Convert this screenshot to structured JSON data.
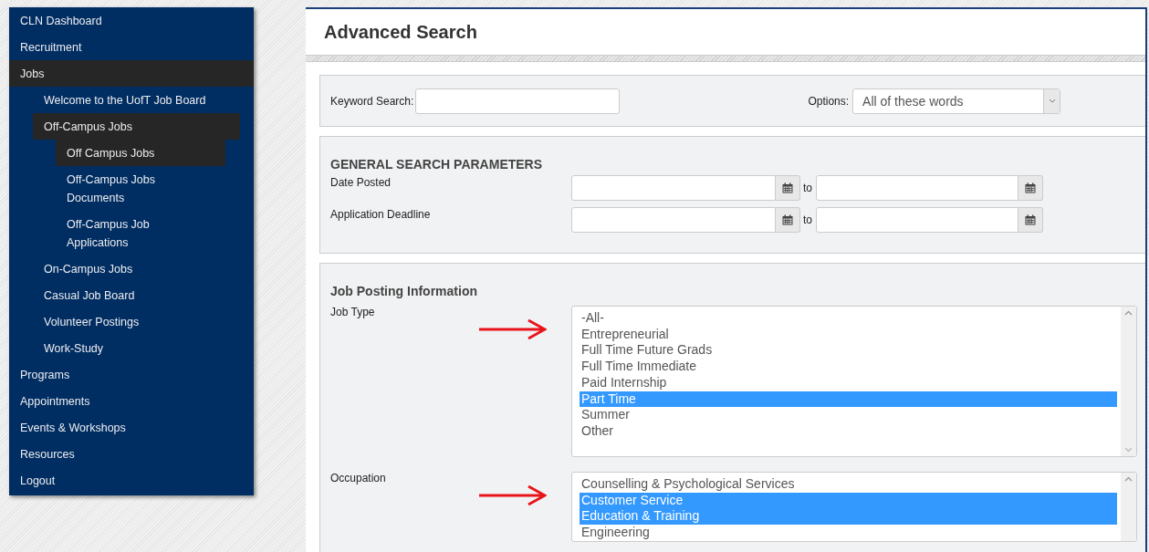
{
  "sidebar": {
    "items": [
      {
        "label": "CLN Dashboard",
        "selected": false
      },
      {
        "label": "Recruitment",
        "selected": false
      },
      {
        "label": "Jobs",
        "selected": true,
        "children": [
          {
            "label": "Welcome to the UofT Job Board",
            "selected": false
          },
          {
            "label": "Off-Campus Jobs",
            "selected": true,
            "children": [
              {
                "label": "Off Campus Jobs",
                "selected": true
              },
              {
                "label": "Off-Campus Jobs Documents",
                "selected": false
              },
              {
                "label": "Off-Campus Job Applications",
                "selected": false
              }
            ]
          },
          {
            "label": "On-Campus Jobs",
            "selected": false
          },
          {
            "label": "Casual Job Board",
            "selected": false
          },
          {
            "label": "Volunteer Postings",
            "selected": false
          },
          {
            "label": "Work-Study",
            "selected": false
          }
        ]
      },
      {
        "label": "Programs",
        "selected": false
      },
      {
        "label": "Appointments",
        "selected": false
      },
      {
        "label": "Events & Workshops",
        "selected": false
      },
      {
        "label": "Resources",
        "selected": false
      },
      {
        "label": "Logout",
        "selected": false
      }
    ]
  },
  "page": {
    "title": "Advanced Search"
  },
  "keyword": {
    "label": "Keyword Search:",
    "options_label": "Options:",
    "options_value": "All of these words"
  },
  "general": {
    "heading": "GENERAL SEARCH PARAMETERS",
    "rows": [
      {
        "label": "Date Posted",
        "to": "to"
      },
      {
        "label": "Application Deadline",
        "to": "to"
      }
    ]
  },
  "job_posting": {
    "heading": "Job Posting Information",
    "lists": [
      {
        "label": "Job Type",
        "options": [
          {
            "label": "-All-",
            "selected": false
          },
          {
            "label": "Entrepreneurial",
            "selected": false
          },
          {
            "label": "Full Time Future Grads",
            "selected": false
          },
          {
            "label": "Full Time Immediate",
            "selected": false
          },
          {
            "label": "Paid Internship",
            "selected": false
          },
          {
            "label": "Part Time",
            "selected": true
          },
          {
            "label": "Summer",
            "selected": false
          },
          {
            "label": "Other",
            "selected": false
          }
        ]
      },
      {
        "label": "Occupation",
        "options": [
          {
            "label": "Counselling & Psychological Services",
            "selected": false
          },
          {
            "label": "Customer Service",
            "selected": true
          },
          {
            "label": "Education & Training",
            "selected": true
          },
          {
            "label": "Engineering",
            "selected": false
          }
        ]
      }
    ]
  }
}
